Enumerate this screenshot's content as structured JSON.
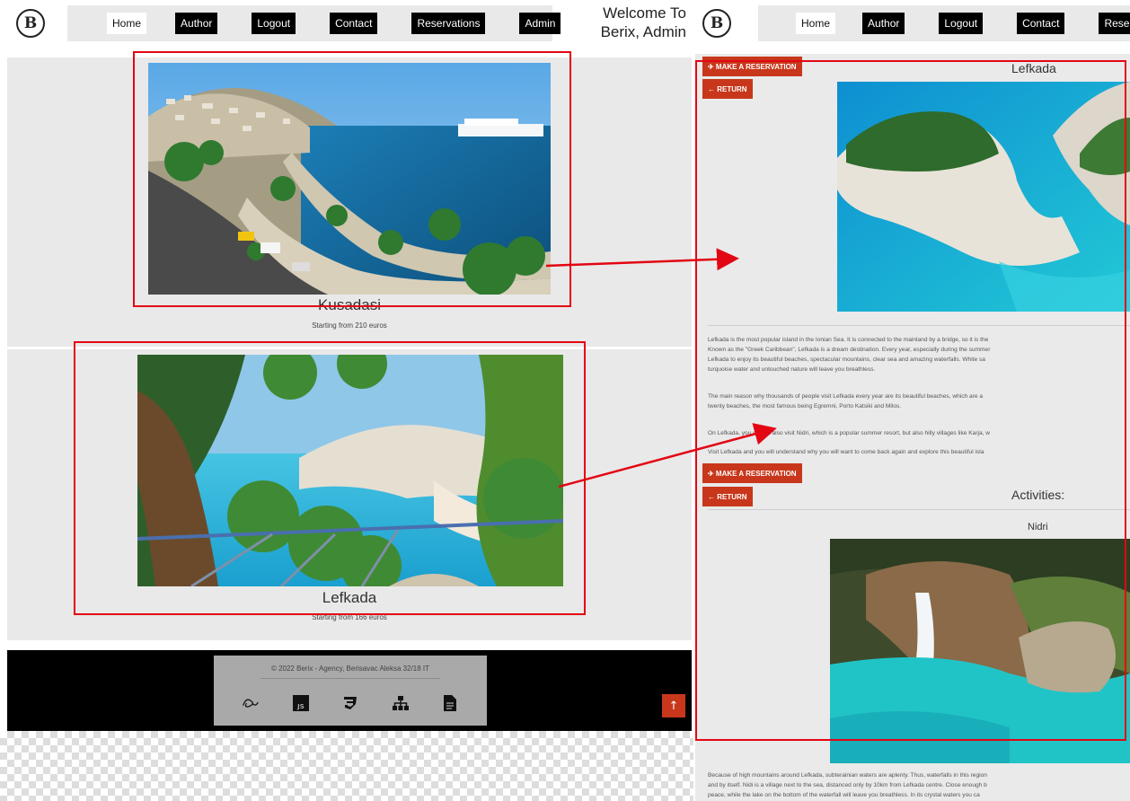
{
  "left": {
    "logo_letter": "B",
    "nav": [
      {
        "label": "Home"
      },
      {
        "label": "Author"
      },
      {
        "label": "Logout"
      },
      {
        "label": "Contact"
      },
      {
        "label": "Reservations"
      },
      {
        "label": "Admin"
      }
    ],
    "welcome": "Welcome To Berix, Admin",
    "destinations": [
      {
        "name": "Kusadasi",
        "price": "Starting from 210 euros"
      },
      {
        "name": "Lefkada",
        "price": "Starting from 166 euros"
      }
    ],
    "footer": {
      "copyright": "© 2022 Berix - Agency, Berisavac Aleksa 32/18 IT",
      "icons": [
        "sass-icon",
        "js-icon",
        "css3-icon",
        "sitemap-icon",
        "document-icon"
      ],
      "scroll_top": "↑"
    }
  },
  "right": {
    "logo_letter": "B",
    "nav": [
      {
        "label": "Home"
      },
      {
        "label": "Author"
      },
      {
        "label": "Logout"
      },
      {
        "label": "Contact"
      },
      {
        "label": "Reservat"
      }
    ],
    "make_reservation": "✈ MAKE A RESERVATION",
    "return": "← RETURN",
    "title": "Lefkada",
    "paragraphs": [
      "Lefkada is the most popular island in the Ionian Sea. It is connected to the mainland by a bridge, so it is the",
      "Known as the \"Greek Caribbean\", Lefkada is a dream destination. Every year, especially during the summer",
      "Lefkada to enjoy its beautiful beaches, spectacular mountains, clear sea and amazing waterfalls. White sa",
      "turquoise water and untouched nature will leave you breathless.",
      "The main reason why thousands of people visit Lefkada every year are its beautiful beaches, which are a",
      "twenty beaches, the most famous being Egremni, Porto Katsiki and Milos.",
      "On Lefkada, you should also visit Nidri, which is a popular summer resort, but also hilly villages like Karja, w",
      "Visit Lefkada and you will understand why you will want to come back again and explore this beautiful isla"
    ],
    "activities_title": "Activities:",
    "activity_name": "Nidri",
    "activity_paragraphs": [
      "Because of high mountains around Lefkada, subterainian waters are aplenty. Thus, waterfalls in this region",
      "and by itself. Nidi is a village next to the sea, distanced only by 10km from Lefkada centre. Close enough b",
      "peace, while the lake on the bottom of the waterfall will leave you breathless. In its crystal waters you ca"
    ]
  },
  "colors": {
    "accent": "#c8371b",
    "highlight": "#e30613",
    "panel_gray": "#e9e9e9"
  }
}
